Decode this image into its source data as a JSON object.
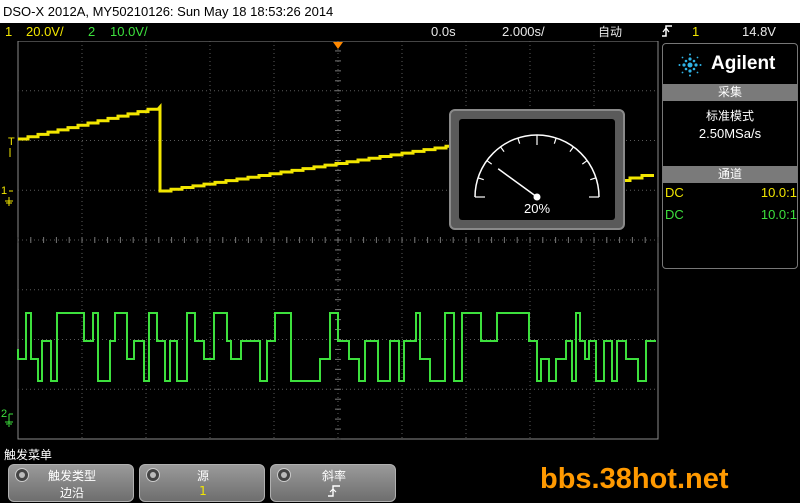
{
  "title": "DSO-X 2012A, MY50210126: Sun May 18 18:53:26 2014",
  "status": {
    "ch1_num": "1",
    "ch1_scale": "20.0V/",
    "ch2_num": "2",
    "ch2_scale": "10.0V/",
    "time_delay": "0.0s",
    "time_scale": "2.000s/",
    "trigger_mode": "自动",
    "trigger_slope_icon": "rising-edge-icon",
    "trigger_source": "1",
    "trigger_level": "14.8V"
  },
  "markers": {
    "trigger_level": "T",
    "ch1_ground": "1",
    "ch2_ground": "2"
  },
  "meter": {
    "value": "20%",
    "fraction": 0.2
  },
  "side_panel": {
    "brand": "Agilent",
    "acquire_header": "采集",
    "acquire_mode": "标准模式",
    "sample_rate": "2.50MSa/s",
    "channels_header": "通道",
    "channels": [
      {
        "coupling": "DC",
        "probe": "10.0:1",
        "color": "#f2e600"
      },
      {
        "coupling": "DC",
        "probe": "10.0:1",
        "color": "#3de03d"
      }
    ]
  },
  "softkeys": {
    "menu_title": "触发菜单",
    "keys": [
      {
        "label": "触发类型",
        "value": "边沿"
      },
      {
        "label": "源",
        "value": "1"
      },
      {
        "label": "斜率",
        "value": ""
      }
    ]
  },
  "watermark": "bbs.38hot.net",
  "colors": {
    "ch1": "#f2e600",
    "ch2": "#3de03d",
    "trigger_marker": "#ff8800"
  }
}
